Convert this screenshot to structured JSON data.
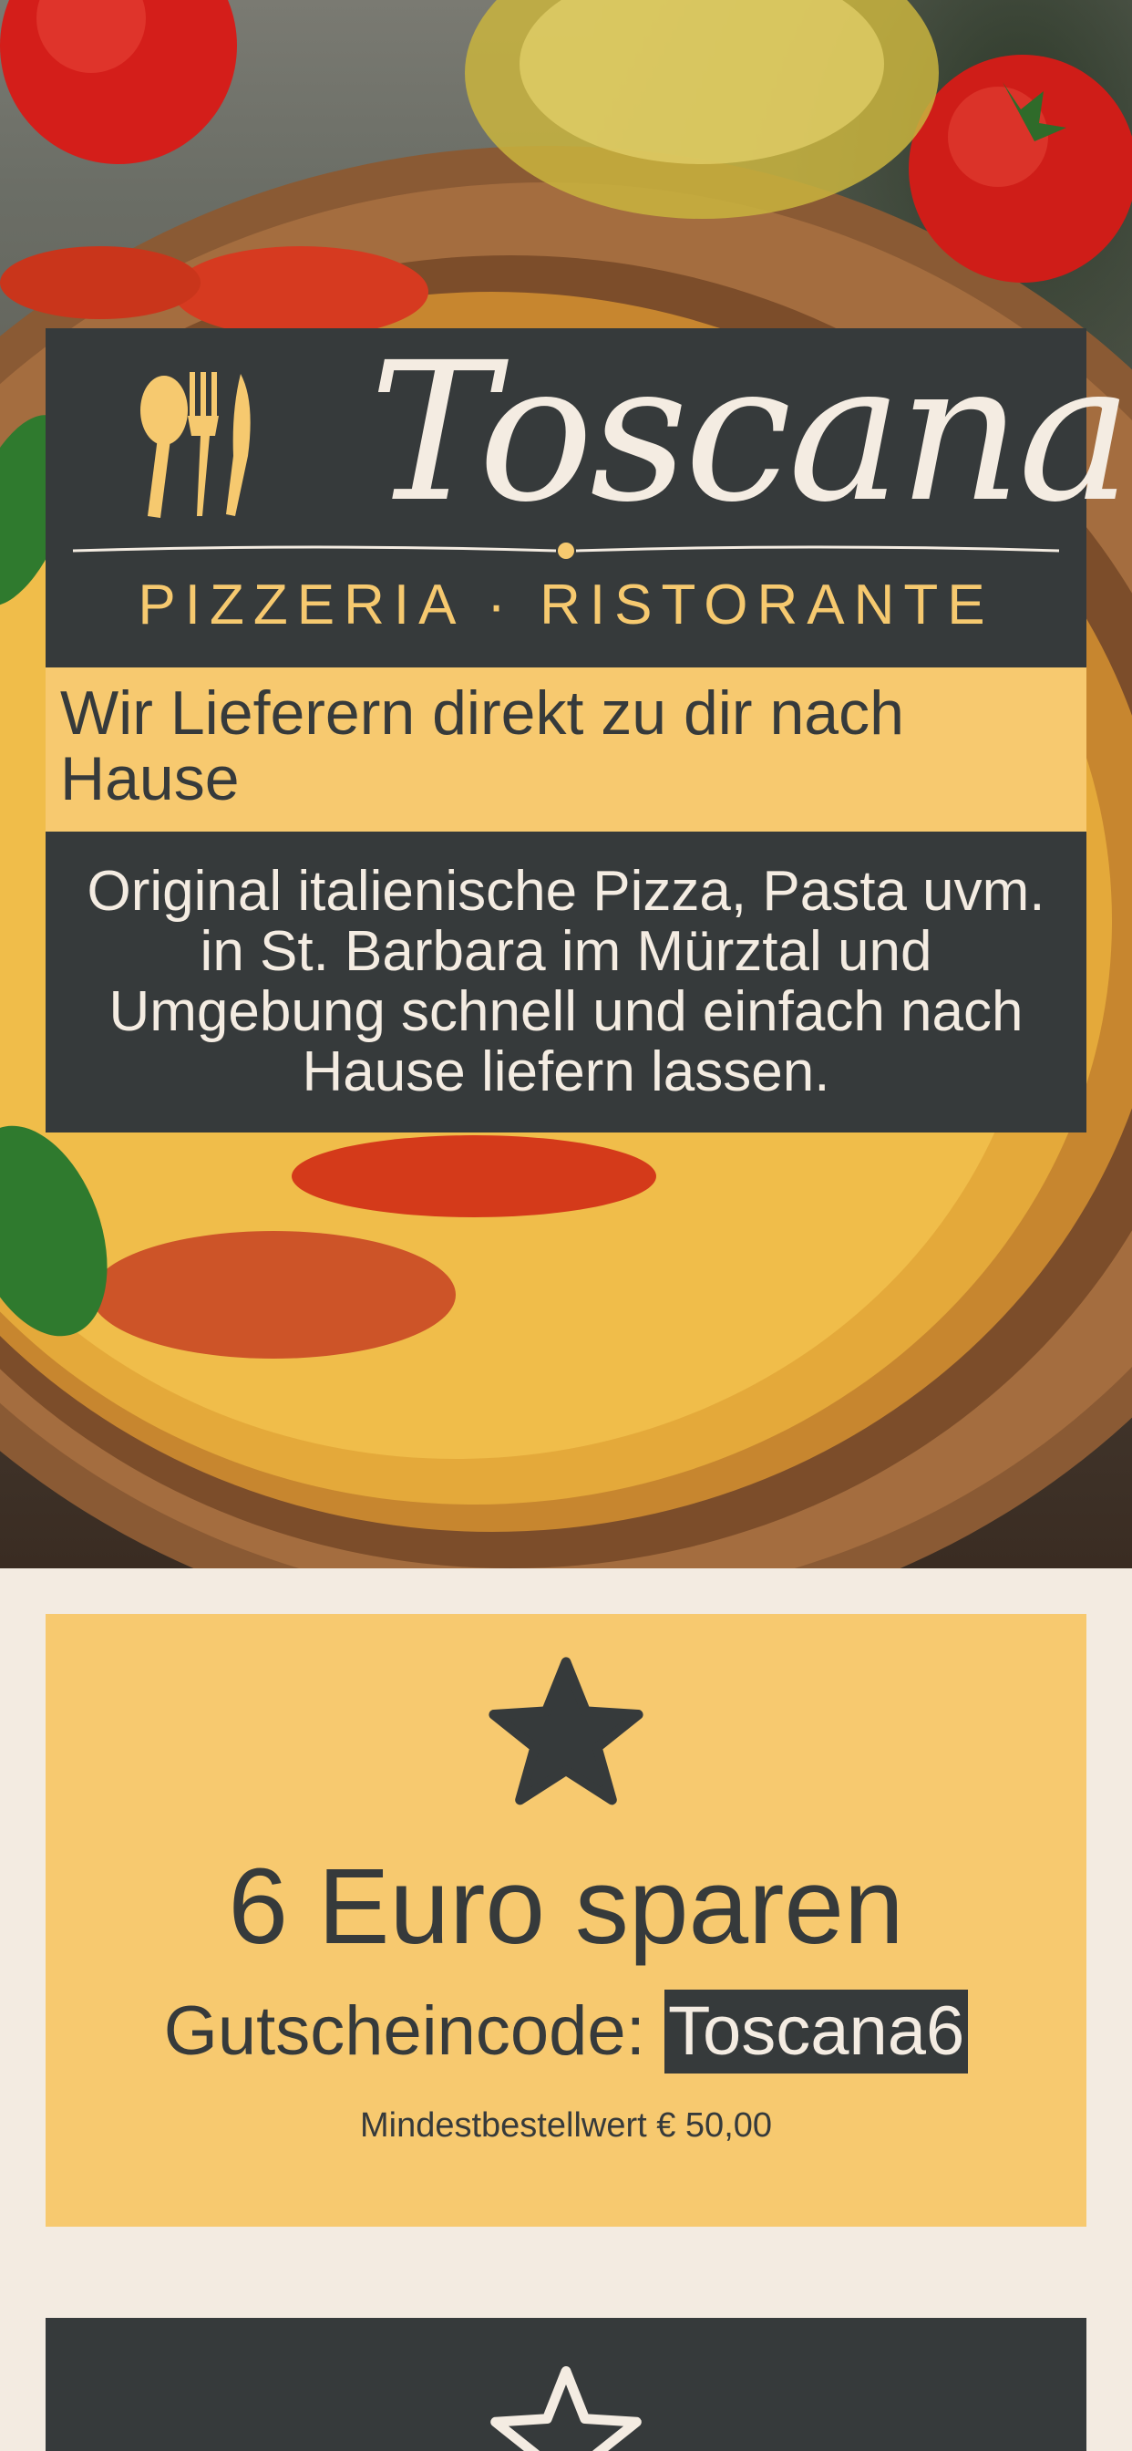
{
  "brand": {
    "name": "Toscana",
    "tagline": "PIZZERIA · RISTORANTE",
    "logo_icon": "cutlery-icon"
  },
  "hero": {
    "image": "pizza-photo",
    "delivery_headline": "Wir Lieferern direkt zu dir nach Hause",
    "description": "Original italienische Pizza, Pasta uvm. in St. Barbara im Mürztal und Umgebung schnell und einfach nach Hause liefern lassen."
  },
  "coupon": {
    "icon": "star-filled-icon",
    "title": "6 Euro sparen",
    "code_label": "Gutscheincode:",
    "code": "Toscana6",
    "minimum": "Mindestbestellwert € 50,00"
  },
  "next_card": {
    "icon": "star-outline-icon"
  },
  "colors": {
    "dark": "#363a3b",
    "accent_yellow": "#f7c96f",
    "cream": "#f4ece2",
    "page_bg": "#f3ebe1"
  }
}
